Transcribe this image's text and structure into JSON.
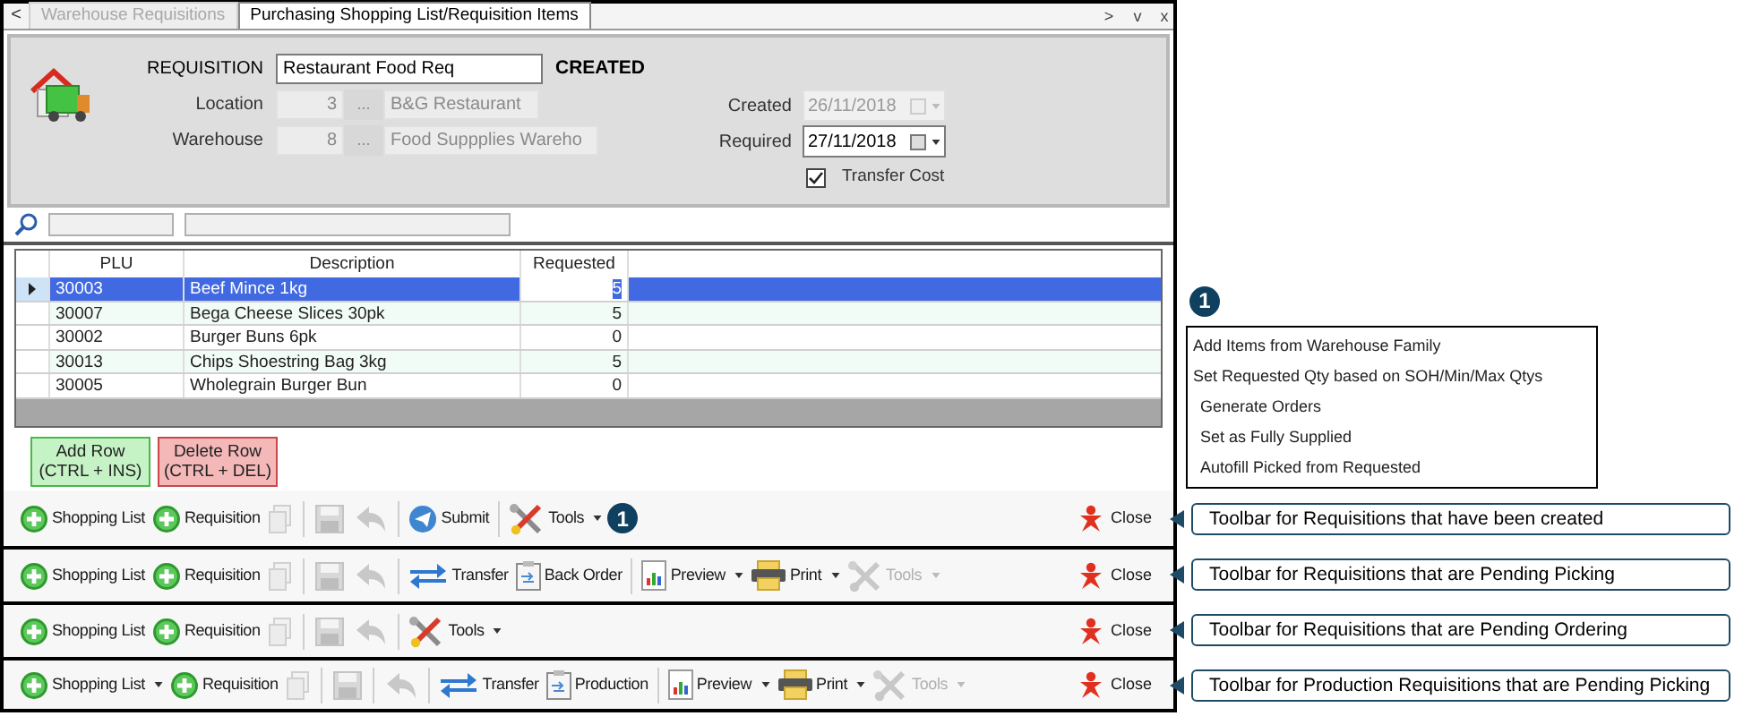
{
  "tab_nav": {
    "back": "<",
    "forward": ">",
    "menu": "v",
    "close": "x"
  },
  "tabs": [
    {
      "label": "Warehouse Requisitions",
      "selected": false
    },
    {
      "label": "Purchasing Shopping List/Requisition Items",
      "selected": true
    }
  ],
  "header": {
    "requisition_label": "REQUISITION",
    "requisition": "Restaurant Food Req",
    "status": "CREATED",
    "location_label": "Location",
    "location_code": "3",
    "location_lookup": "...",
    "location_name": "B&G Restaurant",
    "warehouse_label": "Warehouse",
    "warehouse_code": "8",
    "warehouse_lookup": "...",
    "warehouse_name": "Food Suppplies Wareho",
    "created_label": "Created",
    "created": {
      "value": "26/11/2018",
      "disabled": true
    },
    "required_label": "Required",
    "required": {
      "value": "27/11/2018",
      "disabled": false
    },
    "transfer_cost": {
      "label": "Transfer Cost",
      "checked": true
    }
  },
  "table": {
    "columns": [
      "PLU",
      "Description",
      "Requested"
    ],
    "rows": [
      {
        "plu": "30003",
        "description": "Beef Mince 1kg",
        "requested": "5",
        "selected": true
      },
      {
        "plu": "30007",
        "description": "Bega Cheese Slices 30pk",
        "requested": "5",
        "selected": false
      },
      {
        "plu": "30002",
        "description": "Burger Buns 6pk",
        "requested": "0",
        "selected": false
      },
      {
        "plu": "30013",
        "description": "Chips Shoestring Bag 3kg",
        "requested": "5",
        "selected": false
      },
      {
        "plu": "30005",
        "description": "Wholegrain Burger Bun",
        "requested": "0",
        "selected": false
      }
    ]
  },
  "row_buttons": [
    {
      "kind": "add",
      "label": "Add Row",
      "shortcut": "(CTRL + INS)"
    },
    {
      "kind": "delete",
      "label": "Delete Row",
      "shortcut": "(CTRL + DEL)"
    }
  ],
  "tools_menu": {
    "marker": "1",
    "items": [
      "Add Items from Warehouse Family",
      "Set Requested Qty based on SOH/Min/Max Qtys",
      "Generate Orders",
      "Set as Fully Supplied",
      "Autofill Picked from Requested"
    ]
  },
  "toolbars": [
    {
      "callout": "Toolbar for Requisitions that have been created",
      "close": "Close",
      "items": [
        {
          "kind": "add",
          "label": "Shopping List",
          "disabled": false,
          "dropdown": false
        },
        {
          "kind": "add",
          "label": "Requisition",
          "disabled": false,
          "dropdown": false
        },
        {
          "kind": "copy",
          "disabled": true
        },
        {
          "kind": "separator"
        },
        {
          "kind": "save",
          "disabled": true
        },
        {
          "kind": "undo",
          "disabled": true
        },
        {
          "kind": "separator"
        },
        {
          "kind": "submit",
          "label": "Submit",
          "disabled": false,
          "dropdown": false
        },
        {
          "kind": "separator"
        },
        {
          "kind": "tools",
          "label": "Tools",
          "disabled": false,
          "dropdown": true
        },
        {
          "kind": "marker",
          "label": "1"
        }
      ]
    },
    {
      "callout": "Toolbar for Requisitions that are Pending Picking",
      "close": "Close",
      "items": [
        {
          "kind": "add",
          "label": "Shopping List",
          "disabled": false,
          "dropdown": false
        },
        {
          "kind": "add",
          "label": "Requisition",
          "disabled": false,
          "dropdown": false
        },
        {
          "kind": "copy",
          "disabled": true
        },
        {
          "kind": "separator"
        },
        {
          "kind": "save",
          "disabled": true
        },
        {
          "kind": "undo",
          "disabled": true
        },
        {
          "kind": "separator"
        },
        {
          "kind": "transfer",
          "label": "Transfer",
          "disabled": false,
          "dropdown": false
        },
        {
          "kind": "clipboard",
          "label": "Back Order",
          "disabled": false,
          "dropdown": false
        },
        {
          "kind": "separator"
        },
        {
          "kind": "preview",
          "label": "Preview",
          "disabled": false,
          "dropdown": true
        },
        {
          "kind": "print",
          "label": "Print",
          "disabled": false,
          "dropdown": true
        },
        {
          "kind": "tools",
          "label": "Tools",
          "disabled": true,
          "dropdown": true
        }
      ]
    },
    {
      "callout": "Toolbar for Requisitions that are Pending Ordering",
      "close": "Close",
      "items": [
        {
          "kind": "add",
          "label": "Shopping List",
          "disabled": false,
          "dropdown": false
        },
        {
          "kind": "add",
          "label": "Requisition",
          "disabled": false,
          "dropdown": false
        },
        {
          "kind": "copy",
          "disabled": true
        },
        {
          "kind": "separator"
        },
        {
          "kind": "save",
          "disabled": true
        },
        {
          "kind": "undo",
          "disabled": true
        },
        {
          "kind": "separator"
        },
        {
          "kind": "tools",
          "label": "Tools",
          "disabled": false,
          "dropdown": true
        }
      ]
    },
    {
      "callout": "Toolbar for Production Requisitions that are Pending Picking",
      "close": "Close",
      "items": [
        {
          "kind": "add",
          "label": "Shopping List",
          "disabled": false,
          "dropdown": true
        },
        {
          "kind": "add",
          "label": "Requisition",
          "disabled": false,
          "dropdown": false
        },
        {
          "kind": "copy",
          "disabled": true
        },
        {
          "kind": "separator"
        },
        {
          "kind": "save",
          "disabled": true
        },
        {
          "kind": "separator"
        },
        {
          "kind": "undo",
          "disabled": true
        },
        {
          "kind": "separator"
        },
        {
          "kind": "transfer",
          "label": "Transfer",
          "disabled": false,
          "dropdown": false
        },
        {
          "kind": "clipboard",
          "label": "Production",
          "disabled": false,
          "dropdown": false
        },
        {
          "kind": "separator"
        },
        {
          "kind": "preview",
          "label": "Preview",
          "disabled": false,
          "dropdown": true
        },
        {
          "kind": "print",
          "label": "Print",
          "disabled": false,
          "dropdown": true
        },
        {
          "kind": "tools",
          "label": "Tools",
          "disabled": true,
          "dropdown": true
        }
      ]
    }
  ]
}
